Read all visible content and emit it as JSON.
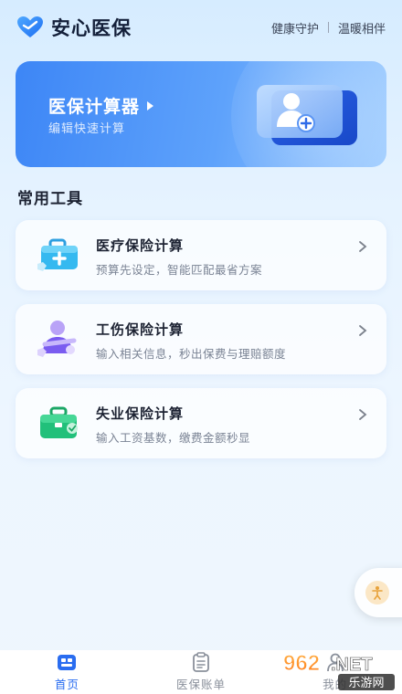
{
  "app": {
    "title": "安心医保",
    "slogan_1": "健康守护",
    "slogan_2": "温暖相伴"
  },
  "banner": {
    "title": "医保计算器",
    "subtitle": "编辑快速计算"
  },
  "section": {
    "title": "常用工具"
  },
  "tools": [
    {
      "name": "医疗保险计算",
      "desc": "预算先设定，智能匹配最省方案",
      "icon": "medical-kit-icon"
    },
    {
      "name": "工伤保险计算",
      "desc": "输入相关信息，秒出保费与理赔额度",
      "icon": "injured-person-icon"
    },
    {
      "name": "失业保险计算",
      "desc": "输入工资基数，缴费金额秒显",
      "icon": "briefcase-icon"
    }
  ],
  "nav": {
    "items": [
      {
        "label": "首页",
        "icon": "home-icon",
        "active": true
      },
      {
        "label": "医保账单",
        "icon": "clipboard-icon",
        "active": false
      },
      {
        "label": "我的",
        "icon": "user-icon",
        "active": false
      }
    ]
  },
  "watermark": {
    "brand": "962.NET",
    "sub": "乐游网"
  },
  "colors": {
    "accent": "#2a6df0",
    "banner_start": "#3d86f6",
    "banner_end": "#9ccbff",
    "tool_1": "#35b9f0",
    "tool_2": "#7a5cf0",
    "tool_3": "#21c07a"
  }
}
